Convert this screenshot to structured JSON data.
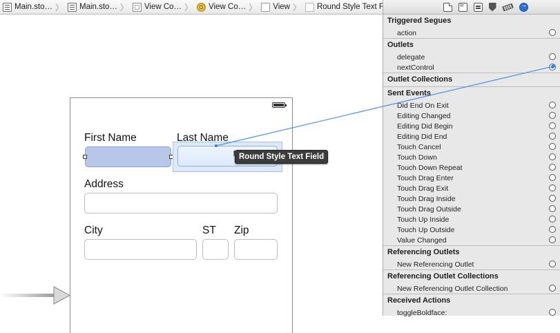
{
  "breadcrumb": [
    {
      "label": "Main.sto…",
      "icon": "document-icon"
    },
    {
      "label": "Main.sto…",
      "icon": "document-icon"
    },
    {
      "label": "View Co…",
      "icon": "view-controller-scene-icon"
    },
    {
      "label": "View Co…",
      "icon": "view-controller-icon"
    },
    {
      "label": "View",
      "icon": "view-icon"
    },
    {
      "label": "Round Style Text Field",
      "icon": "text-field-icon"
    }
  ],
  "scene": {
    "labels": {
      "first_name": "First Name",
      "last_name": "Last Name",
      "address": "Address",
      "city": "City",
      "st": "ST",
      "zip": "Zip"
    },
    "tooltip": "Round Style Text Field"
  },
  "inspector": {
    "tabs": [
      "file-inspector-icon",
      "quick-help-icon",
      "identity-inspector-icon",
      "attributes-inspector-icon",
      "size-inspector-icon",
      "connections-inspector-icon"
    ],
    "sections": {
      "triggered_segues": {
        "title": "Triggered Segues",
        "items": [
          "action"
        ]
      },
      "outlets": {
        "title": "Outlets",
        "items": [
          "delegate",
          "nextControl"
        ]
      },
      "outlet_collections": {
        "title": "Outlet Collections"
      },
      "sent_events": {
        "title": "Sent Events",
        "items": [
          "Did End On Exit",
          "Editing Changed",
          "Editing Did Begin",
          "Editing Did End",
          "Touch Cancel",
          "Touch Down",
          "Touch Down Repeat",
          "Touch Drag Enter",
          "Touch Drag Exit",
          "Touch Drag Inside",
          "Touch Drag Outside",
          "Touch Up Inside",
          "Touch Up Outside",
          "Value Changed"
        ]
      },
      "referencing_outlets": {
        "title": "Referencing Outlets",
        "items": [
          "New Referencing Outlet"
        ]
      },
      "referencing_outlet_collections": {
        "title": "Referencing Outlet Collections",
        "items": [
          "New Referencing Outlet Collection"
        ]
      },
      "received_actions": {
        "title": "Received Actions",
        "items": [
          "toggleBoldface:"
        ]
      }
    }
  },
  "colors": {
    "selection_fill": "#b8c6e7",
    "connection_line": "#4a90e2",
    "connect_circle": "#2f5fa8"
  }
}
